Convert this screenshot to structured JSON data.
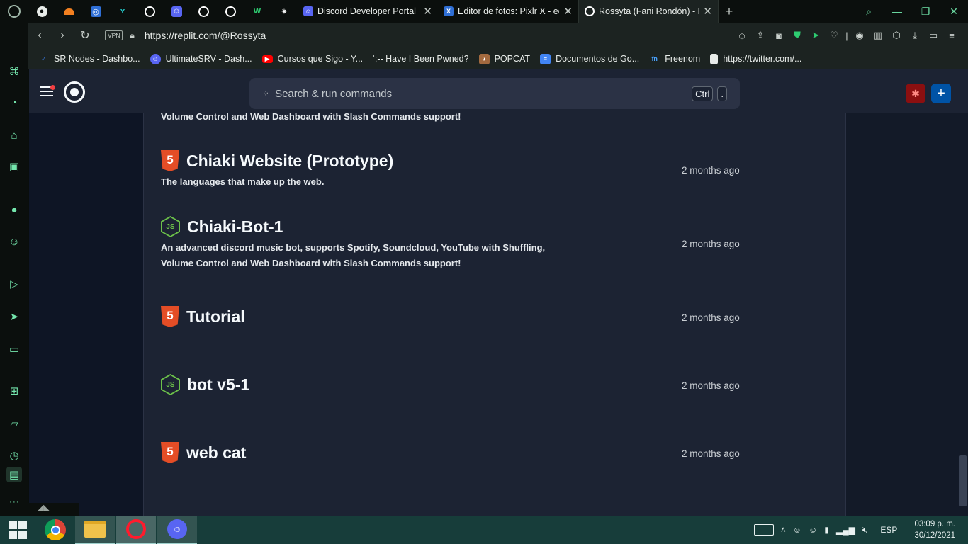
{
  "browser": {
    "tabs": [
      {
        "label": "Discord Developer Portal",
        "icon": "discord-icon",
        "color": "#5865f2"
      },
      {
        "label": "Editor de fotos: Pixlr X - edi",
        "icon": "pixlr-icon",
        "color": "#2f6fd6"
      },
      {
        "label": "Rossyta (Fani Rondón) - Rep",
        "icon": "replit-icon",
        "color": "#f5f9fc",
        "active": true
      }
    ],
    "url": "https://replit.com/@Rossyta",
    "vpn_label": "VPN",
    "bookmarks": [
      {
        "label": "SR Nodes - Dashbo...",
        "icon": "bird-icon",
        "color": "#3b82f6"
      },
      {
        "label": "UltimateSRV - Dash...",
        "icon": "discord-icon",
        "color": "#5865f2"
      },
      {
        "label": "Cursos que Sigo - Y...",
        "icon": "youtube-icon",
        "color": "#ff0000"
      },
      {
        "label": "‘;-- Have I Been Pwned?",
        "icon": "hibp-icon",
        "color": "#1c2321"
      },
      {
        "label": "POPCAT",
        "icon": "cat-icon",
        "color": "#a36a3f"
      },
      {
        "label": "Documentos de Go...",
        "icon": "docs-icon",
        "color": "#4285f4"
      },
      {
        "label": "Freenom",
        "icon": "freenom-icon",
        "color": "#1c5fa8"
      },
      {
        "label": "https://twitter.com/...",
        "icon": "page-icon",
        "color": "#e8ece9"
      }
    ]
  },
  "replit": {
    "search_placeholder": "Search & run commands",
    "shortcut_key1": "Ctrl",
    "shortcut_key2": ".",
    "truncated_desc": "Volume Control and Web Dashboard with Slash Commands support!",
    "repls": [
      {
        "name": "Chiaki Website (Prototype)",
        "lang": "html",
        "desc": "The languages that make up the web.",
        "time": "2 months ago"
      },
      {
        "name": "Chiaki-Bot-1",
        "lang": "nodejs",
        "desc": "An advanced discord music bot, supports Spotify, Soundcloud, YouTube with Shuffling, Volume Control and Web Dashboard with Slash Commands support!",
        "time": "2 months ago"
      },
      {
        "name": "Tutorial",
        "lang": "html",
        "desc": "",
        "time": "2 months ago"
      },
      {
        "name": "bot v5-1",
        "lang": "nodejs",
        "desc": "",
        "time": "2 months ago"
      },
      {
        "name": "web cat",
        "lang": "html",
        "desc": "",
        "time": "2 months ago"
      }
    ]
  },
  "taskbar": {
    "lang": "ESP",
    "time": "03:09 p. m.",
    "date": "30/12/2021"
  }
}
